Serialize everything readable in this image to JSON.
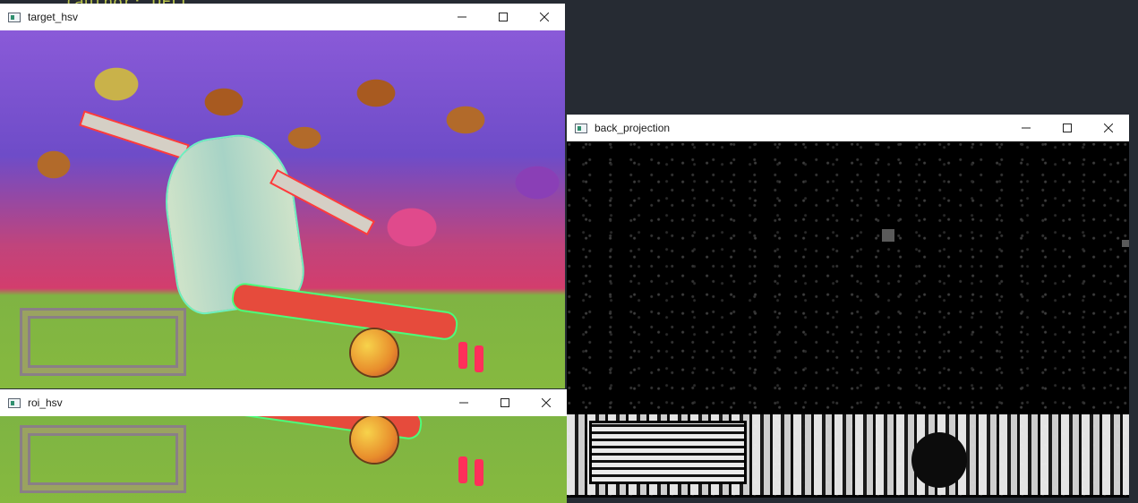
{
  "windows": {
    "target": {
      "title": "target_hsv"
    },
    "roi": {
      "title": "roi_hsv"
    },
    "back": {
      "title": "back_projection"
    }
  },
  "controls": {
    "minimize_icon": "minimize-icon",
    "maximize_icon": "maximize-icon",
    "close_icon": "close-icon"
  },
  "editor": {
    "fragment": "(author: DELL"
  }
}
